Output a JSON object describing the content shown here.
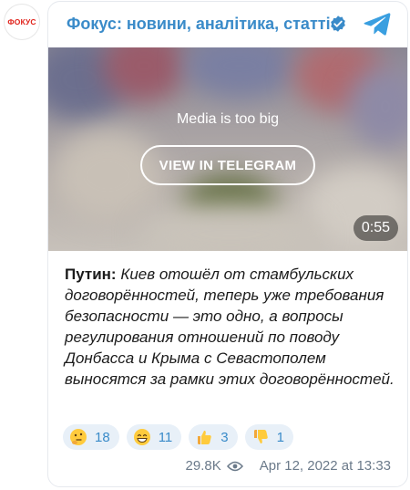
{
  "avatar": {
    "logo_text": "ФОКУС"
  },
  "channel": {
    "title": "Фокус: новини, аналітика, статті"
  },
  "media": {
    "notice": "Media is too big",
    "view_button": "VIEW IN TELEGRAM",
    "duration": "0:55"
  },
  "message": {
    "speaker": "Путин:",
    "text": "Киев отошёл от стамбульских договорённостей, теперь уже требования безопасности — это одно, а вопросы регулирования отношений по поводу Донбасса и Крыма с Севастополем выносятся за рамки этих договорённостей."
  },
  "reactions": [
    {
      "icon": "thinking-face-emoji",
      "count": "18"
    },
    {
      "icon": "grinning-face-emoji",
      "count": "11"
    },
    {
      "icon": "thumbs-up-emoji",
      "count": "3"
    },
    {
      "icon": "thumbs-down-emoji",
      "count": "1"
    }
  ],
  "footer": {
    "views": "29.8K",
    "views_icon": "eye-icon",
    "timestamp": "Apr 12, 2022 at 13:33"
  },
  "colors": {
    "accent": "#3a8bc9",
    "logo_red": "#e0231c",
    "reaction_bg": "#e8f0f8"
  }
}
